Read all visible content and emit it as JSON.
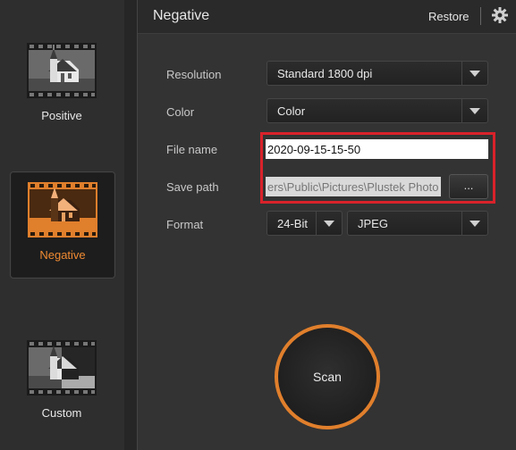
{
  "sidebar": {
    "modes": [
      {
        "label": "Positive",
        "selected": false
      },
      {
        "label": "Negative",
        "selected": true
      },
      {
        "label": "Custom",
        "selected": false
      }
    ]
  },
  "header": {
    "title": "Negative",
    "restore_label": "Restore",
    "settings_icon": "gear-icon"
  },
  "form": {
    "resolution": {
      "label": "Resolution",
      "value": "Standard 1800 dpi"
    },
    "color": {
      "label": "Color",
      "value": "Color"
    },
    "file_name": {
      "label": "File name",
      "value": "2020-09-15-15-50"
    },
    "save_path": {
      "label": "Save path",
      "value": "ers\\Public\\Pictures\\Plustek Photo",
      "browse_label": "..."
    },
    "format": {
      "label": "Format",
      "bit_depth": "24-Bit",
      "file_type": "JPEG"
    }
  },
  "scan_button": {
    "label": "Scan"
  },
  "colors": {
    "accent": "#e07f2c",
    "highlight": "#d9222a",
    "panel": "#333333"
  }
}
